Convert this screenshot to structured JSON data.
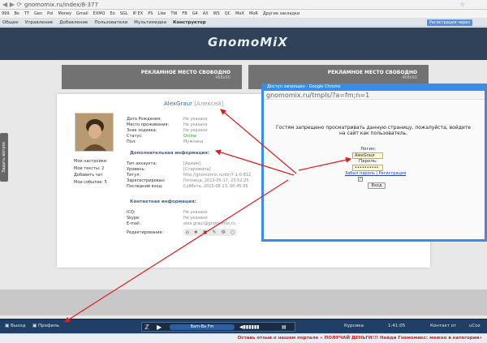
{
  "browser": {
    "url": "gnomomix.ru/index/8-377"
  },
  "bookmarks": [
    "999",
    "Вк",
    "TT",
    "Gen",
    "Pol",
    "Money",
    "Gmail",
    "EXMO",
    "Ео",
    "SGL",
    "IP EX",
    "PS",
    "Like",
    "TW",
    "FB",
    "G4",
    "AX",
    "WS",
    "QC",
    "MeX",
    "MoR",
    "Другие закладки"
  ],
  "adminbar": {
    "items": [
      "Общее",
      "Управление",
      "Добавление",
      "Пользователи",
      "Мультимедиа",
      "Конструктор"
    ],
    "reg": "Регистрация через"
  },
  "site": {
    "logo": "GnomoMiX"
  },
  "ads": [
    {
      "label": "РЕКЛАМНОЕ МЕСТО СВОБОДНО",
      "size": "468x60"
    },
    {
      "label": "РЕКЛАМНОЕ МЕСТО СВОБОДНО",
      "size": "468x60"
    }
  ],
  "profile": {
    "username": "AlexGraur",
    "realname": "[Алексей]",
    "left_stats": [
      "Мои настройки",
      "Мои тексты: 2",
      "Добавить чат",
      "Мои событие: 5"
    ],
    "rows": [
      {
        "k": "Дата Рождения:",
        "v": "Не указано"
      },
      {
        "k": "Место проживания:",
        "v": "Не указано"
      },
      {
        "k": "Знак зодиака:",
        "v": "Не указано"
      },
      {
        "k": "Статус:",
        "v": "Online"
      },
      {
        "k": "Пол:",
        "v": "Мужчина"
      }
    ],
    "extra_title": "Дополнительная информация:",
    "extra": [
      {
        "k": "Тип аккаунта:",
        "v": "[Админ]"
      },
      {
        "k": "Уровень:",
        "v": "[Старожила]"
      },
      {
        "k": "Титул:",
        "v": "http://gnomomix.ru/dir/7-1-0-812"
      },
      {
        "k": "Зарегистрирован:",
        "v": "Пятница, 2013-05-17, 23:52:25"
      },
      {
        "k": "Последний вход:",
        "v": "Суббота, 2015-06-13, 00:45:35"
      }
    ],
    "contact_title": "Контактная информация:",
    "contact": [
      {
        "k": "ICQ:",
        "v": "Не указано"
      },
      {
        "k": "Skype:",
        "v": "Не указано"
      },
      {
        "k": "E-mail:",
        "v": "alex.graur@gnomomix.ru"
      },
      {
        "k": "Редактирование:",
        "v": ""
      }
    ]
  },
  "sidetab": "Задать вопрос",
  "dialog": {
    "title": "Доступ запрещен - Google Chrome",
    "url": "gnomomix.ru/tmpls/?a=fm;n=1",
    "message": "Гостям запрещено просматривать данную страницу, пожалуйста, войдите на сайт как пользователь.",
    "login_label": "Логин:",
    "login_value": "AlexGraur",
    "password_label": "Пароль:",
    "password_value": "••••••••••",
    "forgot": "Забыл пароль",
    "register": "Регистрация",
    "submit": "Вход"
  },
  "bottom": {
    "exit": "Выход",
    "profile": "Профиль",
    "station": "Bam-Ba Fm",
    "time": "1:41:05",
    "kurs": "Курсика",
    "kontakt": "Контакт от",
    "ucoz": "uCoz"
  },
  "ticker": "Оставь отзыв о нашем портале « ПОЛУЧАЙ ДЕНЬГИ!!! Найди Гномомикс: можно в категории»"
}
